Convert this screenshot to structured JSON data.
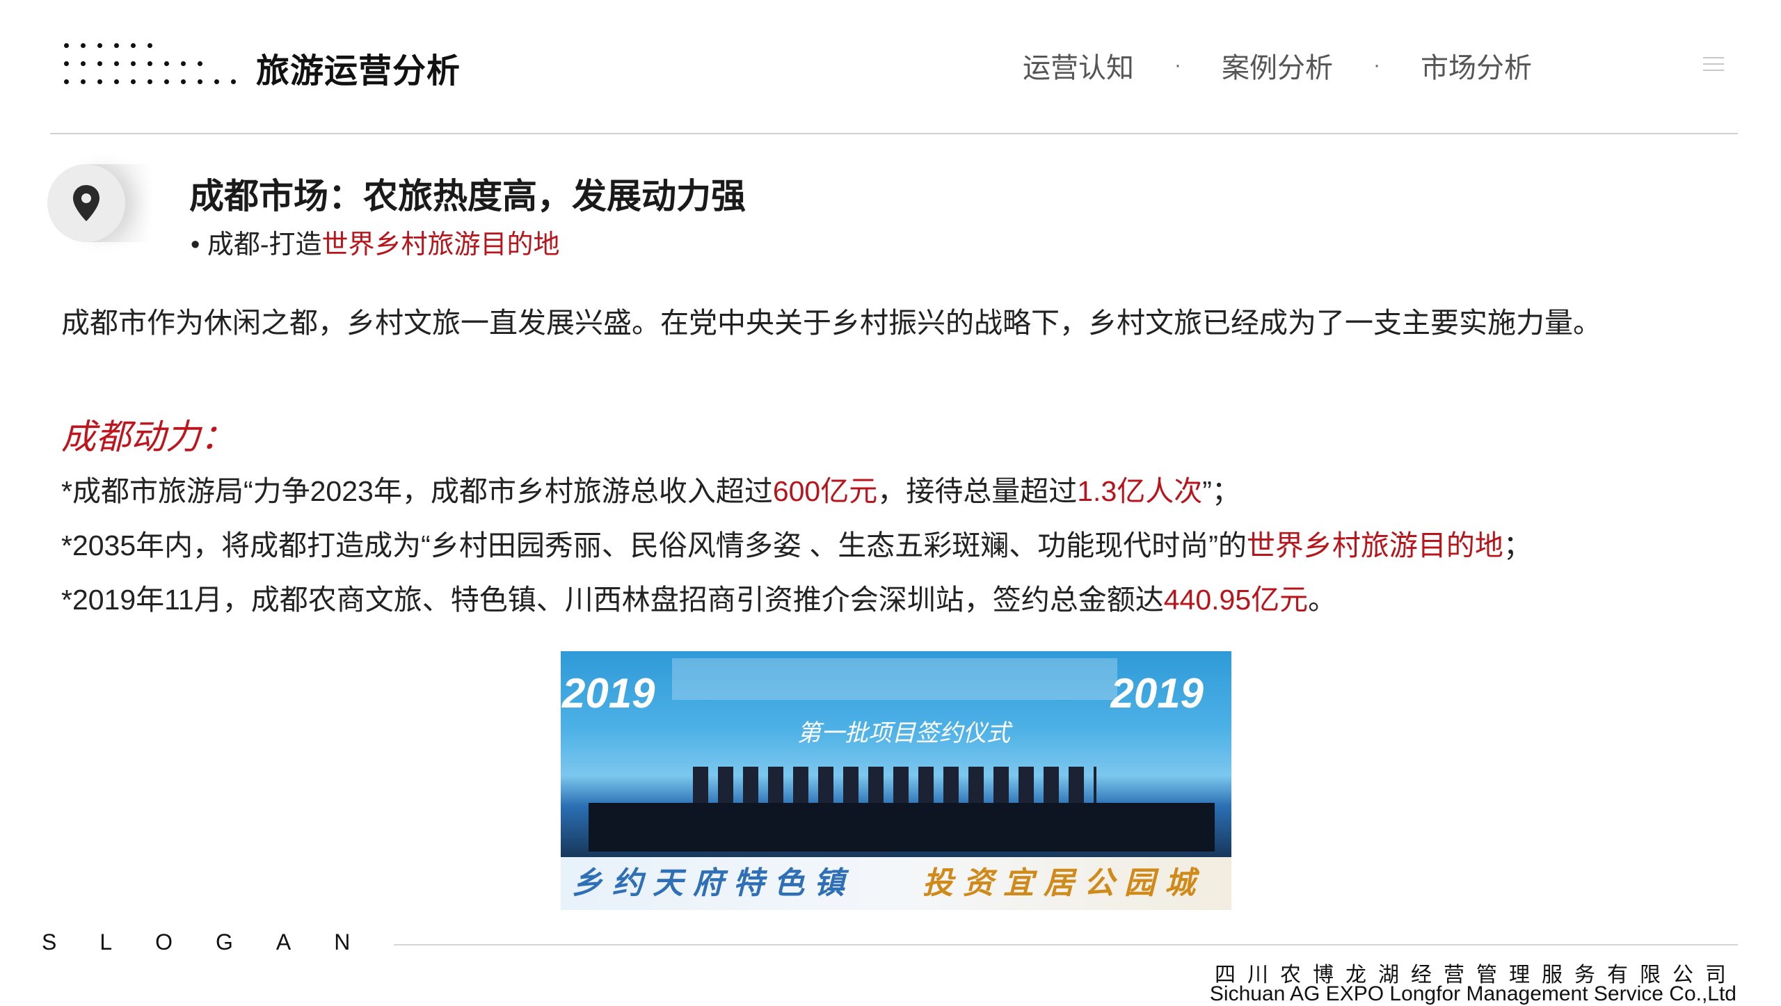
{
  "header": {
    "title": "旅游运营分析",
    "nav": [
      {
        "label": "运营认知"
      },
      {
        "label": "案例分析"
      },
      {
        "label": "市场分析"
      }
    ],
    "separator": "·",
    "menu_icon": "hamburger-icon"
  },
  "section": {
    "icon": "location-pin-icon",
    "title": "成都市场：农旅热度高，发展动力强",
    "subtitle_prefix": "• 成都-打造",
    "subtitle_highlight": "世界乡村旅游目的地"
  },
  "intro": "成都市作为休闲之都，乡村文旅一直发展兴盛。在党中央关于乡村振兴的战略下，乡村文旅已经成为了一支主要实施力量。",
  "power": {
    "heading": "成都动力：",
    "points": [
      {
        "a": "*成都市旅游局“力争2023年，成都市乡村旅游总收入超过",
        "b": "600亿元",
        "c": "，接待总量超过",
        "d": "1.3亿人次",
        "e": "”；"
      },
      {
        "a": "*2035年内，将成都打造成为“乡村田园秀丽、民俗风情多姿 、生态五彩斑斓、功能现代时尚”的",
        "b": "世界乡村旅游目的地",
        "c": "；"
      },
      {
        "a": "*2019年11月，成都农商文旅、特色镇、川西林盘招商引资推介会深圳站，签约总金额达",
        "b": "440.95亿元",
        "c": "。"
      }
    ]
  },
  "photo": {
    "year_left": "2019",
    "year_right": "2019",
    "caption": "第一批项目签约仪式",
    "banner_left": "乡约天府特色镇",
    "banner_right": "投资宜居公园城"
  },
  "footer": {
    "slogan": "SLOGAN",
    "company_cn": "四川农博龙湖经营管理服务有限公司",
    "company_en": "Sichuan AG EXPO Longfor Management Service Co.,Ltd"
  },
  "colors": {
    "accent_red": "#b8141c",
    "text": "#222222",
    "rule": "#d0d0d0"
  }
}
